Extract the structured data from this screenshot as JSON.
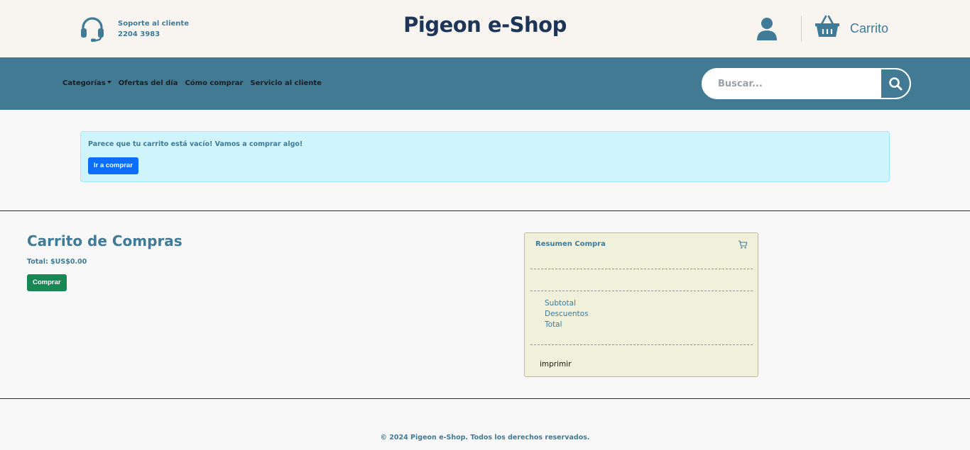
{
  "header": {
    "support_label": "Soporte al cliente",
    "support_phone": "2204 3983",
    "brand": "Pigeon e-Shop",
    "cart_label": "Carrito"
  },
  "nav": {
    "items": [
      "Categorías",
      "Ofertas del día",
      "Cómo comprar",
      "Servicio al cliente"
    ],
    "search_placeholder": "Buscar..."
  },
  "alert": {
    "message": "Parece que tu carrito está vacío! Vamos a comprar algo!",
    "button": "Ir a comprar"
  },
  "cart": {
    "title": "Carrito de Compras",
    "total": "Total: $US$0.00",
    "button": "Comprar"
  },
  "summary": {
    "title": "Resumen Compra",
    "rows": [
      "Subtotal",
      "Descuentos",
      "Total"
    ],
    "print": "imprimir"
  },
  "footer": {
    "text": "© 2024 Pigeon e-Shop. Todos los derechos reservados."
  },
  "colors": {
    "accent": "#427a94",
    "brand": "#1d3557",
    "alert_bg": "#cff4fc",
    "primary": "#0d6efd",
    "success": "#198754",
    "summary_bg": "#f1f0da"
  }
}
